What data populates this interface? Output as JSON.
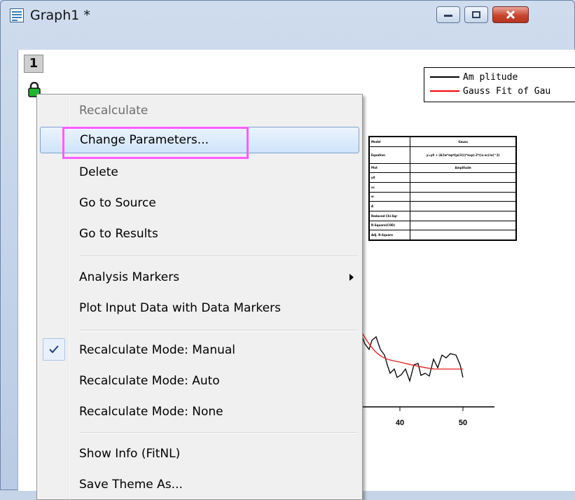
{
  "window": {
    "title": "Graph1 *",
    "buttons": {
      "minimize": "minimize",
      "maximize": "maximize",
      "close": "close"
    }
  },
  "graph": {
    "layer_number": "1",
    "legend": [
      {
        "label": "Am plitude",
        "color": "#000000"
      },
      {
        "label": "Gauss Fit of Gau",
        "color": "#ff0000"
      }
    ],
    "fit_table": [
      [
        "Model",
        "Gauss"
      ],
      [
        "Equation",
        "y=y0 + (A/(w*sqrt(pi/2)))*exp(-2*((x-xc)/w)^2)"
      ],
      [
        "Plot",
        "Amplitude"
      ],
      [
        "y0",
        ""
      ],
      [
        "xc",
        ""
      ],
      [
        "w",
        ""
      ],
      [
        "A",
        ""
      ],
      [
        "Reduced Chi-Sqr",
        ""
      ],
      [
        "R-Square(COD)",
        ""
      ],
      [
        "Adj. R-Square",
        ""
      ]
    ],
    "axis_ticks": [
      "40",
      "50"
    ],
    "colors": {
      "data": "#000000",
      "fit": "#e8201a"
    }
  },
  "context_menu": {
    "items": [
      {
        "label": "Recalculate",
        "disabled": true
      },
      {
        "label": "Change Parameters...",
        "highlighted": true
      },
      {
        "label": "Delete"
      },
      {
        "label": "Go to Source"
      },
      {
        "label": "Go to Results"
      },
      {
        "label": "Analysis Markers",
        "submenu": true
      },
      {
        "label": "Plot Input Data with Data Markers"
      },
      {
        "label": "Recalculate Mode: Manual",
        "checked": true
      },
      {
        "label": "Recalculate Mode: Auto"
      },
      {
        "label": "Recalculate Mode: None"
      },
      {
        "label": "Show Info (FitNL)"
      },
      {
        "label": "Save Theme As..."
      }
    ]
  },
  "annotation": {
    "color": "#ff5cff"
  }
}
